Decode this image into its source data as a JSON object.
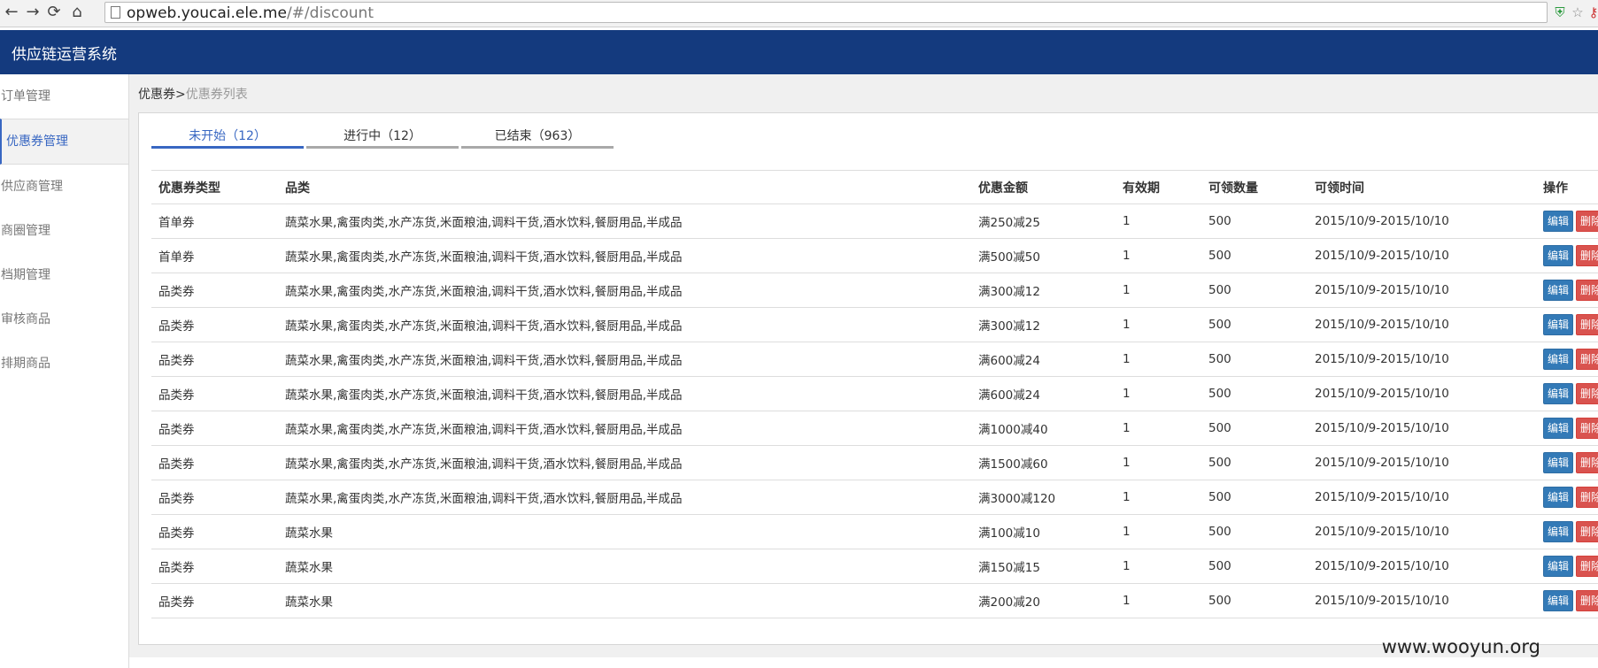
{
  "browser": {
    "url_host": "opweb.youcai.ele.me",
    "url_path": "/#/discount",
    "back_glyph": "←",
    "forward_glyph": "→",
    "reload_glyph": "⟳",
    "home_glyph": "⌂",
    "shield_glyph": "⛨",
    "star_glyph": "☆",
    "key_glyph": "⚷"
  },
  "header": {
    "title": "供应链运营系统"
  },
  "sidebar": {
    "items": [
      {
        "label": "订单管理"
      },
      {
        "label": "优惠券管理"
      },
      {
        "label": "供应商管理"
      },
      {
        "label": "商圈管理"
      },
      {
        "label": "档期管理"
      },
      {
        "label": "审核商品"
      },
      {
        "label": "排期商品"
      }
    ]
  },
  "breadcrumb": {
    "parent": "优惠券",
    "sep": ">",
    "current": "优惠券列表"
  },
  "tabs": [
    {
      "label": "未开始（12）"
    },
    {
      "label": "进行中（12）"
    },
    {
      "label": "已结束（963）"
    }
  ],
  "table": {
    "headers": [
      "优惠券类型",
      "品类",
      "优惠金额",
      "有效期",
      "可领数量",
      "可领时间",
      "操作"
    ],
    "edit_label": "编辑",
    "delete_label": "删除",
    "rows": [
      {
        "type": "首单券",
        "category": "蔬菜水果,禽蛋肉类,水产冻货,米面粮油,调料干货,酒水饮料,餐厨用品,半成品",
        "amount": "满250减25",
        "validity": "1",
        "quantity": "500",
        "time": "2015/10/9-2015/10/10"
      },
      {
        "type": "首单券",
        "category": "蔬菜水果,禽蛋肉类,水产冻货,米面粮油,调料干货,酒水饮料,餐厨用品,半成品",
        "amount": "满500减50",
        "validity": "1",
        "quantity": "500",
        "time": "2015/10/9-2015/10/10"
      },
      {
        "type": "品类券",
        "category": "蔬菜水果,禽蛋肉类,水产冻货,米面粮油,调料干货,酒水饮料,餐厨用品,半成品",
        "amount": "满300减12",
        "validity": "1",
        "quantity": "500",
        "time": "2015/10/9-2015/10/10"
      },
      {
        "type": "品类券",
        "category": "蔬菜水果,禽蛋肉类,水产冻货,米面粮油,调料干货,酒水饮料,餐厨用品,半成品",
        "amount": "满300减12",
        "validity": "1",
        "quantity": "500",
        "time": "2015/10/9-2015/10/10"
      },
      {
        "type": "品类券",
        "category": "蔬菜水果,禽蛋肉类,水产冻货,米面粮油,调料干货,酒水饮料,餐厨用品,半成品",
        "amount": "满600减24",
        "validity": "1",
        "quantity": "500",
        "time": "2015/10/9-2015/10/10"
      },
      {
        "type": "品类券",
        "category": "蔬菜水果,禽蛋肉类,水产冻货,米面粮油,调料干货,酒水饮料,餐厨用品,半成品",
        "amount": "满600减24",
        "validity": "1",
        "quantity": "500",
        "time": "2015/10/9-2015/10/10"
      },
      {
        "type": "品类券",
        "category": "蔬菜水果,禽蛋肉类,水产冻货,米面粮油,调料干货,酒水饮料,餐厨用品,半成品",
        "amount": "满1000减40",
        "validity": "1",
        "quantity": "500",
        "time": "2015/10/9-2015/10/10"
      },
      {
        "type": "品类券",
        "category": "蔬菜水果,禽蛋肉类,水产冻货,米面粮油,调料干货,酒水饮料,餐厨用品,半成品",
        "amount": "满1500减60",
        "validity": "1",
        "quantity": "500",
        "time": "2015/10/9-2015/10/10"
      },
      {
        "type": "品类券",
        "category": "蔬菜水果,禽蛋肉类,水产冻货,米面粮油,调料干货,酒水饮料,餐厨用品,半成品",
        "amount": "满3000减120",
        "validity": "1",
        "quantity": "500",
        "time": "2015/10/9-2015/10/10"
      },
      {
        "type": "品类券",
        "category": "蔬菜水果",
        "amount": "满100减10",
        "validity": "1",
        "quantity": "500",
        "time": "2015/10/9-2015/10/10"
      },
      {
        "type": "品类券",
        "category": "蔬菜水果",
        "amount": "满150减15",
        "validity": "1",
        "quantity": "500",
        "time": "2015/10/9-2015/10/10"
      },
      {
        "type": "品类券",
        "category": "蔬菜水果",
        "amount": "满200减20",
        "validity": "1",
        "quantity": "500",
        "time": "2015/10/9-2015/10/10"
      }
    ]
  },
  "watermark": "www.wooyun.org",
  "colors": {
    "header_bg": "#143a7e",
    "accent": "#3867c2",
    "edit_btn": "#337ab7",
    "delete_btn": "#d9534f"
  }
}
